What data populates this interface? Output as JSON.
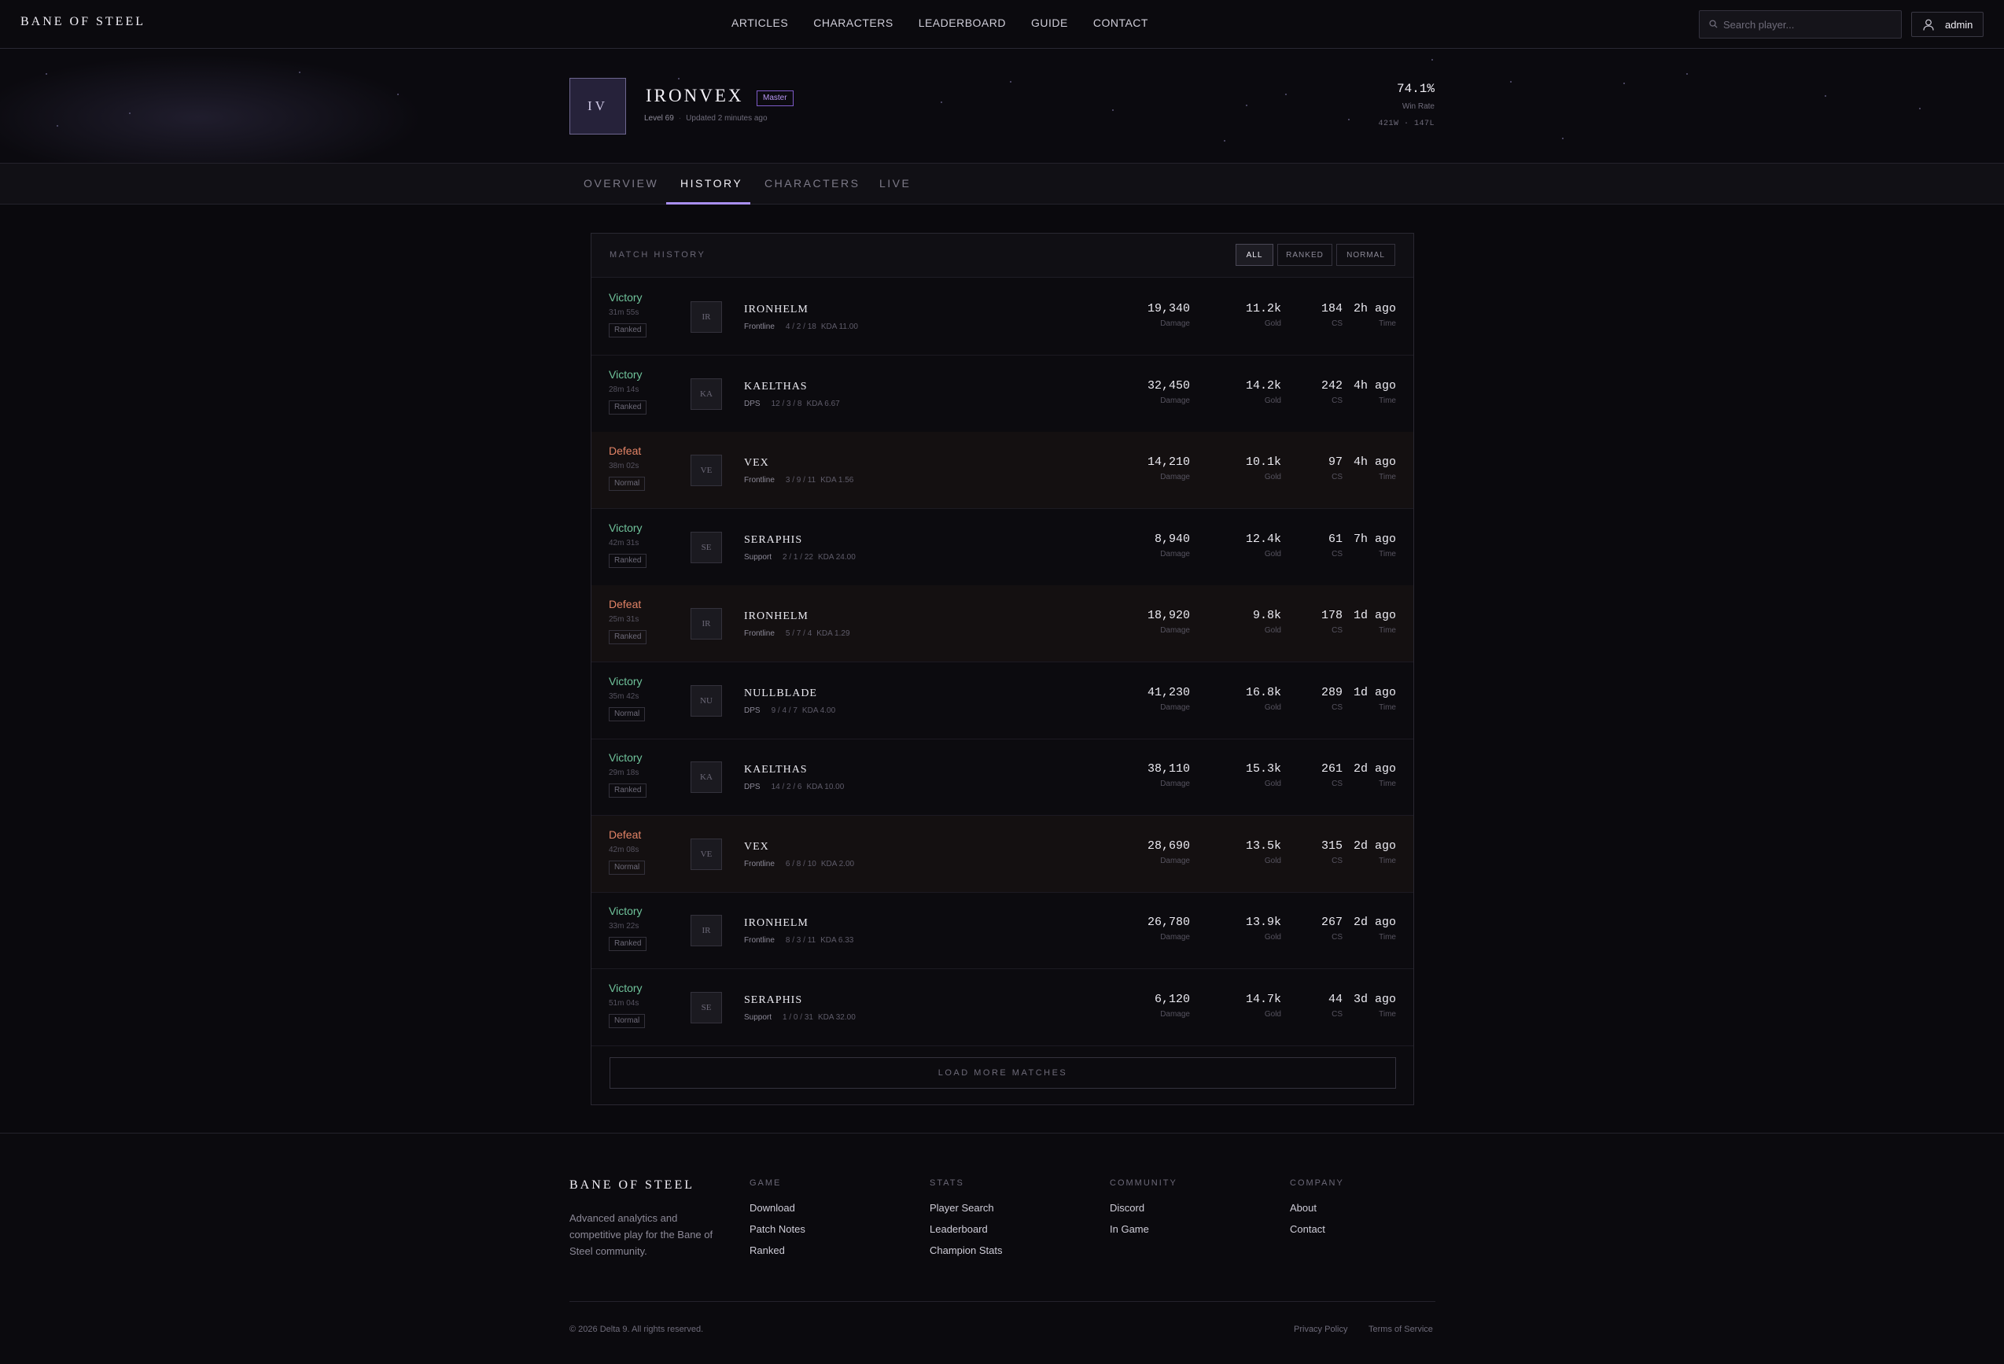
{
  "nav": {
    "brand": "BANE OF STEEL",
    "links": [
      "ARTICLES",
      "CHARACTERS",
      "LEADERBOARD",
      "GUIDE",
      "CONTACT"
    ],
    "search_placeholder": "Search player...",
    "user": "admin"
  },
  "profile": {
    "initials": "IV",
    "name": "IRONVEX",
    "rank": "Master",
    "level": "Level 69",
    "updated": "Updated 2 minutes ago",
    "win_rate": "74.1%",
    "win_rate_label": "Win Rate",
    "record": "421W · 147L"
  },
  "tabs": [
    "OVERVIEW",
    "HISTORY",
    "CHARACTERS",
    "LIVE"
  ],
  "active_tab": "HISTORY",
  "history": {
    "title": "MATCH HISTORY",
    "filters": [
      "ALL",
      "RANKED",
      "NORMAL"
    ],
    "active_filter": "ALL",
    "labels": {
      "damage": "Damage",
      "gold": "Gold",
      "cs": "CS",
      "time": "Time"
    },
    "matches": [
      {
        "result": "Victory",
        "outcome": "victory",
        "duration": "31m 55s",
        "queue": "Ranked",
        "initials": "IR",
        "champion": "IRONHELM",
        "role": "Frontline",
        "score": "4 / 2 / 18",
        "kda": "KDA 11.00",
        "damage": "19,340",
        "gold": "11.2k",
        "cs": "184",
        "time": "2h ago"
      },
      {
        "result": "Victory",
        "outcome": "victory",
        "duration": "28m 14s",
        "queue": "Ranked",
        "initials": "KA",
        "champion": "KAELTHAS",
        "role": "DPS",
        "score": "12 / 3 / 8",
        "kda": "KDA 6.67",
        "damage": "32,450",
        "gold": "14.2k",
        "cs": "242",
        "time": "4h ago"
      },
      {
        "result": "Defeat",
        "outcome": "defeat",
        "duration": "38m 02s",
        "queue": "Normal",
        "initials": "VE",
        "champion": "VEX",
        "role": "Frontline",
        "score": "3 / 9 / 11",
        "kda": "KDA 1.56",
        "damage": "14,210",
        "gold": "10.1k",
        "cs": "97",
        "time": "4h ago"
      },
      {
        "result": "Victory",
        "outcome": "victory",
        "duration": "42m 31s",
        "queue": "Ranked",
        "initials": "SE",
        "champion": "SERAPHIS",
        "role": "Support",
        "score": "2 / 1 / 22",
        "kda": "KDA 24.00",
        "damage": "8,940",
        "gold": "12.4k",
        "cs": "61",
        "time": "7h ago"
      },
      {
        "result": "Defeat",
        "outcome": "defeat",
        "duration": "25m 31s",
        "queue": "Ranked",
        "initials": "IR",
        "champion": "IRONHELM",
        "role": "Frontline",
        "score": "5 / 7 / 4",
        "kda": "KDA 1.29",
        "damage": "18,920",
        "gold": "9.8k",
        "cs": "178",
        "time": "1d ago"
      },
      {
        "result": "Victory",
        "outcome": "victory",
        "duration": "35m 42s",
        "queue": "Normal",
        "initials": "NU",
        "champion": "NULLBLADE",
        "role": "DPS",
        "score": "9 / 4 / 7",
        "kda": "KDA 4.00",
        "damage": "41,230",
        "gold": "16.8k",
        "cs": "289",
        "time": "1d ago"
      },
      {
        "result": "Victory",
        "outcome": "victory",
        "duration": "29m 18s",
        "queue": "Ranked",
        "initials": "KA",
        "champion": "KAELTHAS",
        "role": "DPS",
        "score": "14 / 2 / 6",
        "kda": "KDA 10.00",
        "damage": "38,110",
        "gold": "15.3k",
        "cs": "261",
        "time": "2d ago"
      },
      {
        "result": "Defeat",
        "outcome": "defeat",
        "duration": "42m 08s",
        "queue": "Normal",
        "initials": "VE",
        "champion": "VEX",
        "role": "Frontline",
        "score": "6 / 8 / 10",
        "kda": "KDA 2.00",
        "damage": "28,690",
        "gold": "13.5k",
        "cs": "315",
        "time": "2d ago"
      },
      {
        "result": "Victory",
        "outcome": "victory",
        "duration": "33m 22s",
        "queue": "Ranked",
        "initials": "IR",
        "champion": "IRONHELM",
        "role": "Frontline",
        "score": "8 / 3 / 11",
        "kda": "KDA 6.33",
        "damage": "26,780",
        "gold": "13.9k",
        "cs": "267",
        "time": "2d ago"
      },
      {
        "result": "Victory",
        "outcome": "victory",
        "duration": "51m 04s",
        "queue": "Normal",
        "initials": "SE",
        "champion": "SERAPHIS",
        "role": "Support",
        "score": "1 / 0 / 31",
        "kda": "KDA 32.00",
        "damage": "6,120",
        "gold": "14.7k",
        "cs": "44",
        "time": "3d ago"
      }
    ],
    "load_more": "LOAD MORE MATCHES"
  },
  "footer": {
    "brand": "BANE OF STEEL",
    "description": "Advanced analytics and competitive play for the Bane of Steel community.",
    "columns": [
      {
        "heading": "GAME",
        "links": [
          "Download",
          "Patch Notes",
          "Ranked"
        ]
      },
      {
        "heading": "STATS",
        "links": [
          "Player Search",
          "Leaderboard",
          "Champion Stats"
        ]
      },
      {
        "heading": "COMMUNITY",
        "links": [
          "Discord",
          "In Game"
        ]
      },
      {
        "heading": "COMPANY",
        "links": [
          "About",
          "Contact"
        ]
      }
    ],
    "copyright": "© 2026 Delta 9. All rights reserved.",
    "legal": [
      "Privacy Policy",
      "Terms of Service"
    ]
  },
  "colors": {
    "accent": "#a98ff0",
    "victory": "#6fc29a",
    "defeat": "#e28366",
    "rank_badge": "#b796f2"
  },
  "icons": {
    "search": "magnifier-icon",
    "user": "user-icon"
  }
}
